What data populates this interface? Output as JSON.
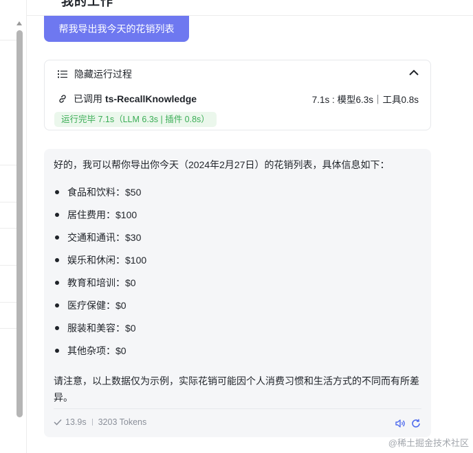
{
  "header": {
    "title_fragment": "我的工作"
  },
  "user_message": {
    "text": "帮我导出我今天的花销列表"
  },
  "run_card": {
    "toggle_label": "隐藏运行过程",
    "tool_prefix": "已调用",
    "tool_name": "ts-RecallKnowledge",
    "tool_metrics": "7.1s : 模型6.3s｜工具0.8s",
    "status_badge": "运行完毕 7.1s（LLM 6.3s | 插件 0.8s）"
  },
  "answer": {
    "intro": "好的，我可以帮你导出你今天（2024年2月27日）的花销列表，具体信息如下：",
    "items": [
      "食品和饮料：$50",
      "居住费用：$100",
      "交通和通讯：$30",
      "娱乐和休闲：$100",
      "教育和培训：$0",
      "医疗保健：$0",
      "服装和美容：$0",
      "其他杂项：$0"
    ],
    "note": "请注意，以上数据仅为示例，实际花销可能因个人消费习惯和生活方式的不同而有所差异。",
    "duration": "13.9s",
    "tokens": "3203 Tokens"
  },
  "watermark": "@稀土掘金技术社区",
  "colors": {
    "accent": "#6e78f0",
    "success": "#3aad55",
    "success_bg": "#ebf7ec"
  }
}
